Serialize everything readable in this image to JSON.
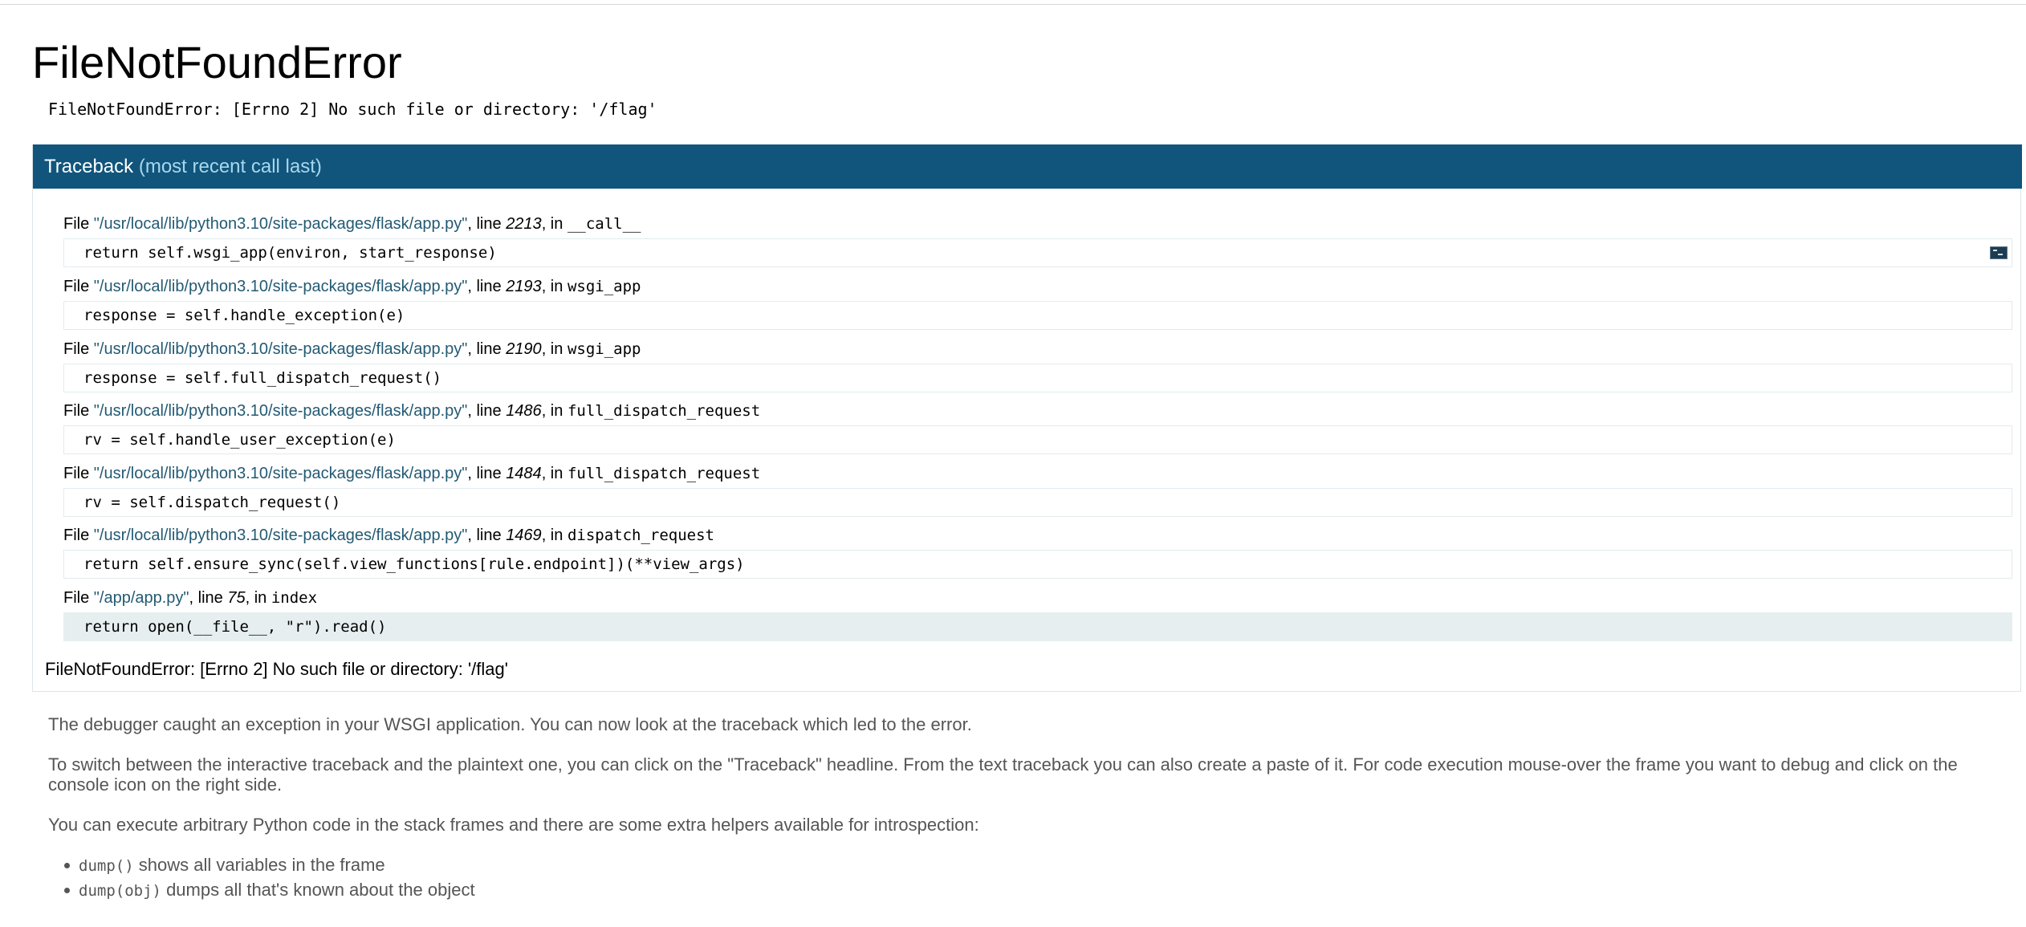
{
  "page_title": "FileNotFoundError",
  "error_message": "FileNotFoundError: [Errno 2] No such file or directory: '/flag'",
  "traceback": {
    "header_label": "Traceback",
    "header_sub": "(most recent call last)",
    "frames": [
      {
        "file_prefix": "File ",
        "path": "\"/usr/local/lib/python3.10/site-packages/flask/app.py\"",
        "line_prefix": ", line ",
        "line": "2213",
        "in_prefix": ", in ",
        "function": "__call__",
        "code": "return self.wsgi_app(environ, start_response)"
      },
      {
        "file_prefix": "File ",
        "path": "\"/usr/local/lib/python3.10/site-packages/flask/app.py\"",
        "line_prefix": ", line ",
        "line": "2193",
        "in_prefix": ", in ",
        "function": "wsgi_app",
        "code": "response = self.handle_exception(e)"
      },
      {
        "file_prefix": "File ",
        "path": "\"/usr/local/lib/python3.10/site-packages/flask/app.py\"",
        "line_prefix": ", line ",
        "line": "2190",
        "in_prefix": ", in ",
        "function": "wsgi_app",
        "code": "response = self.full_dispatch_request()"
      },
      {
        "file_prefix": "File ",
        "path": "\"/usr/local/lib/python3.10/site-packages/flask/app.py\"",
        "line_prefix": ", line ",
        "line": "1486",
        "in_prefix": ", in ",
        "function": "full_dispatch_request",
        "code": "rv = self.handle_user_exception(e)"
      },
      {
        "file_prefix": "File ",
        "path": "\"/usr/local/lib/python3.10/site-packages/flask/app.py\"",
        "line_prefix": ", line ",
        "line": "1484",
        "in_prefix": ", in ",
        "function": "full_dispatch_request",
        "code": "rv = self.dispatch_request()"
      },
      {
        "file_prefix": "File ",
        "path": "\"/usr/local/lib/python3.10/site-packages/flask/app.py\"",
        "line_prefix": ", line ",
        "line": "1469",
        "in_prefix": ", in ",
        "function": "dispatch_request",
        "code": "return self.ensure_sync(self.view_functions[rule.endpoint])(**view_args)"
      },
      {
        "file_prefix": "File ",
        "path": "\"/app/app.py\"",
        "line_prefix": ", line ",
        "line": "75",
        "in_prefix": ", in ",
        "function": "index",
        "code": "return open(__file__, \"r\").read()"
      }
    ],
    "final_error": "FileNotFoundError: [Errno 2] No such file or directory: '/flag'"
  },
  "explanation": {
    "p1": "The debugger caught an exception in your WSGI application. You can now look at the traceback which led to the error.",
    "p2": "To switch between the interactive traceback and the plaintext one, you can click on the \"Traceback\" headline. From the text traceback you can also create a paste of it. For code execution mouse-over the frame you want to debug and click on the console icon on the right side.",
    "p3": "You can execute arbitrary Python code in the stack frames and there are some extra helpers available for introspection:",
    "helpers": [
      {
        "code": "dump()",
        "text": " shows all variables in the frame"
      },
      {
        "code": "dump(obj)",
        "text": " dumps all that's known about the object"
      }
    ]
  },
  "colors": {
    "header_bg": "#11557c",
    "header_sub": "#a8d7ec",
    "path": "#235a73",
    "explanation_text": "#555555",
    "current_line_bg": "#e6eeef"
  },
  "icons": {
    "console": "console-icon"
  }
}
